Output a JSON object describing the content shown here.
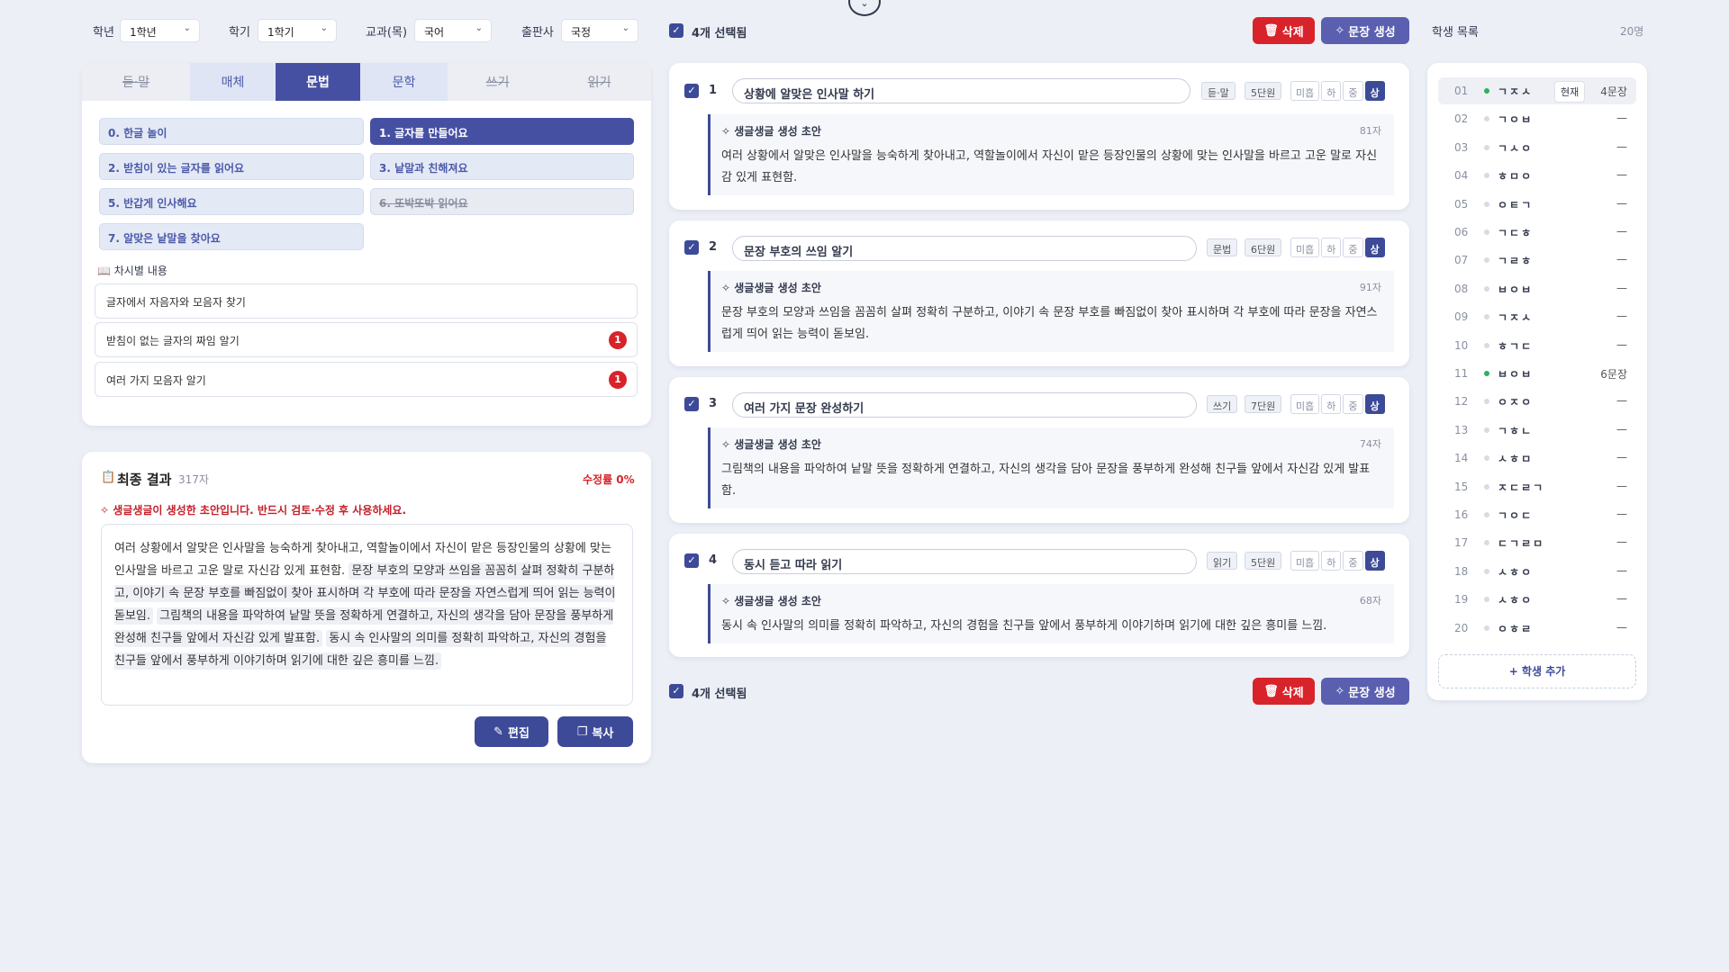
{
  "filters": {
    "grade_label": "학년",
    "grade_value": "1학년",
    "semester_label": "학기",
    "semester_value": "1학기",
    "subject_label": "교과(목)",
    "subject_value": "국어",
    "publisher_label": "출판사",
    "publisher_value": "국정"
  },
  "tabs": [
    {
      "label": "듣·말",
      "state": "strike"
    },
    {
      "label": "매체",
      "state": "normal"
    },
    {
      "label": "문법",
      "state": "active"
    },
    {
      "label": "문학",
      "state": "normal"
    },
    {
      "label": "쓰기",
      "state": "strike"
    },
    {
      "label": "읽기",
      "state": "strike"
    }
  ],
  "lessons": [
    {
      "label": "0. 한글 놀이"
    },
    {
      "label": "1. 글자를 만들어요"
    },
    {
      "label": "2. 받침이 있는 글자를 읽어요"
    },
    {
      "label": "3. 낱말과 친해져요"
    },
    {
      "label": "5. 반갑게 인사해요"
    },
    {
      "label": "6. 또박또박 읽어요"
    },
    {
      "label": "7. 알맞은 낱말을 찾아요"
    }
  ],
  "section": {
    "label": "📖 차시별 내용"
  },
  "contents": [
    {
      "label": "글자에서 자음자와 모음자 찾기"
    },
    {
      "label": "받침이 없는 글자의 짜임 알기",
      "badge": "1"
    },
    {
      "label": "여러 가지 모음자 알기",
      "badge": "1"
    }
  ],
  "result": {
    "title": "최종 결과",
    "count": "317자",
    "rate": "수정률 0%",
    "warning": "생글생글이 생성한 초안입니다. 반드시 검토·수정 후 사용하세요.",
    "segments": [
      "여러 상황에서 알맞은 인사말을 능숙하게 찾아내고, 역할놀이에서 자신이 맡은 등장인물의 상황에 맞는 인사말을 바르고 고운 말로 자신감 있게 표현함.",
      "문장 부호의 모양과 쓰임을 꼼꼼히 살펴 정확히 구분하고, 이야기 속 문장 부호를 빠짐없이 찾아 표시하며 각 부호에 따라 문장을 자연스럽게 띄어 읽는 능력이 돋보임.",
      "그림책의 내용을 파악하여 낱말 뜻을 정확하게 연결하고, 자신의 생각을 담아 문장을 풍부하게 완성해 친구들 앞에서 자신감 있게 발표함.",
      "동시 속 인사말의 의미를 정확히 파악하고, 자신의 경험을 친구들 앞에서 풍부하게 이야기하며 읽기에 대한 깊은 흥미를 느낌."
    ],
    "edit_label": "편집",
    "copy_label": "복사"
  },
  "toolbar": {
    "selected_text": "4개 선택됨",
    "delete_label": "삭제",
    "generate_label": "문장 생성"
  },
  "items": [
    {
      "num": "1",
      "title": "상황에 알맞은 인사말 하기",
      "area": "듣·말",
      "unit": "5단원",
      "levels": [
        "미흡",
        "하",
        "중",
        "상"
      ],
      "draft_label": "생글생글 생성 초안",
      "count": "81자",
      "text": "여러 상황에서 알맞은 인사말을 능숙하게 찾아내고, 역할놀이에서 자신이 맡은 등장인물의 상황에 맞는 인사말을 바르고 고운 말로 자신감 있게 표현함."
    },
    {
      "num": "2",
      "title": "문장 부호의 쓰임 알기",
      "area": "문법",
      "unit": "6단원",
      "levels": [
        "미흡",
        "하",
        "중",
        "상"
      ],
      "draft_label": "생글생글 생성 초안",
      "count": "91자",
      "text": "문장 부호의 모양과 쓰임을 꼼꼼히 살펴 정확히 구분하고, 이야기 속 문장 부호를 빠짐없이 찾아 표시하며 각 부호에 따라 문장을 자연스럽게 띄어 읽는 능력이 돋보임."
    },
    {
      "num": "3",
      "title": "여러 가지 문장 완성하기",
      "area": "쓰기",
      "unit": "7단원",
      "levels": [
        "미흡",
        "하",
        "중",
        "상"
      ],
      "draft_label": "생글생글 생성 초안",
      "count": "74자",
      "text": "그림책의 내용을 파악하여 낱말 뜻을 정확하게 연결하고, 자신의 생각을 담아 문장을 풍부하게 완성해 친구들 앞에서 자신감 있게 발표함."
    },
    {
      "num": "4",
      "title": "동시 듣고 따라 읽기",
      "area": "읽기",
      "unit": "5단원",
      "levels": [
        "미흡",
        "하",
        "중",
        "상"
      ],
      "draft_label": "생글생글 생성 초안",
      "count": "68자",
      "text": "동시 속 인사말의 의미를 정확히 파악하고, 자신의 경험을 친구들 앞에서 풍부하게 이야기하며 읽기에 대한 깊은 흥미를 느낌."
    }
  ],
  "students": {
    "title": "학생 목록",
    "count": "20명",
    "current_label": "현재",
    "add_label": "+ 학생 추가",
    "list": [
      {
        "num": "01",
        "name": "ㄱㅈㅅ",
        "status": "4문장",
        "dot": "green",
        "current": true
      },
      {
        "num": "02",
        "name": "ㄱㅇㅂ",
        "status": "—",
        "dot": "gray"
      },
      {
        "num": "03",
        "name": "ㄱㅅㅇ",
        "status": "—",
        "dot": "gray"
      },
      {
        "num": "04",
        "name": "ㅎㅁㅇ",
        "status": "—",
        "dot": "gray"
      },
      {
        "num": "05",
        "name": "ㅇㅌㄱ",
        "status": "—",
        "dot": "gray"
      },
      {
        "num": "06",
        "name": "ㄱㄷㅎ",
        "status": "—",
        "dot": "gray"
      },
      {
        "num": "07",
        "name": "ㄱㄹㅎ",
        "status": "—",
        "dot": "gray"
      },
      {
        "num": "08",
        "name": "ㅂㅇㅂ",
        "status": "—",
        "dot": "gray"
      },
      {
        "num": "09",
        "name": "ㄱㅈㅅ",
        "status": "—",
        "dot": "gray"
      },
      {
        "num": "10",
        "name": "ㅎㄱㄷ",
        "status": "—",
        "dot": "gray"
      },
      {
        "num": "11",
        "name": "ㅂㅇㅂ",
        "status": "6문장",
        "dot": "green"
      },
      {
        "num": "12",
        "name": "ㅇㅈㅇ",
        "status": "—",
        "dot": "gray"
      },
      {
        "num": "13",
        "name": "ㄱㅎㄴ",
        "status": "—",
        "dot": "gray"
      },
      {
        "num": "14",
        "name": "ㅅㅎㅁ",
        "status": "—",
        "dot": "gray"
      },
      {
        "num": "15",
        "name": "ㅈㄷㄹㄱ",
        "status": "—",
        "dot": "gray"
      },
      {
        "num": "16",
        "name": "ㄱㅇㄷ",
        "status": "—",
        "dot": "gray"
      },
      {
        "num": "17",
        "name": "ㄷㄱㄹㅁ",
        "status": "—",
        "dot": "gray"
      },
      {
        "num": "18",
        "name": "ㅅㅎㅇ",
        "status": "—",
        "dot": "gray"
      },
      {
        "num": "19",
        "name": "ㅅㅎㅇ",
        "status": "—",
        "dot": "gray"
      },
      {
        "num": "20",
        "name": "ㅇㅎㄹ",
        "status": "—",
        "dot": "gray"
      }
    ]
  },
  "colors": {
    "accent": "#3d4a98",
    "tab_active": "#4650a3",
    "danger": "#d8232a",
    "generate": "#5a5fb0",
    "background": "#eceff6"
  }
}
